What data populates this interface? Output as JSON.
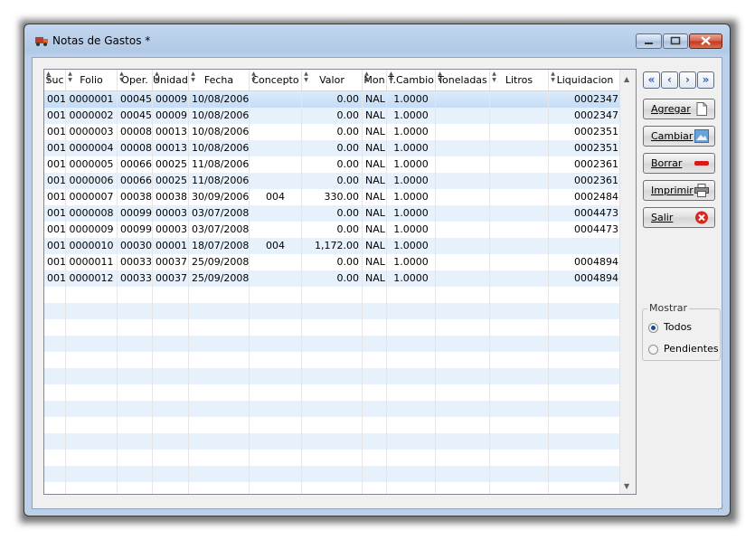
{
  "window": {
    "title": "Notas de Gastos *"
  },
  "grid": {
    "columns": [
      {
        "label": "Suc",
        "w": 24,
        "align": "l"
      },
      {
        "label": "Folio",
        "w": 57,
        "align": "c"
      },
      {
        "label": "Oper.",
        "w": 39,
        "align": "c"
      },
      {
        "label": "Unidad",
        "w": 40,
        "align": "c"
      },
      {
        "label": "Fecha",
        "w": 67,
        "align": "l"
      },
      {
        "label": "Concepto",
        "w": 58,
        "align": "c"
      },
      {
        "label": "Valor",
        "w": 67,
        "align": "r"
      },
      {
        "label": "Mon",
        "w": 27,
        "align": "l"
      },
      {
        "label": "T.Cambio",
        "w": 54,
        "align": "c"
      },
      {
        "label": "Toneladas",
        "w": 60,
        "align": "c"
      },
      {
        "label": "Litros",
        "w": 65,
        "align": "c"
      },
      {
        "label": "Liquidacion",
        "w": 81,
        "align": "r"
      }
    ],
    "rows": [
      [
        "001",
        "0000001",
        "00045",
        "00009",
        "10/08/2006",
        "",
        "0.00",
        "NAL",
        "1.0000",
        "",
        "",
        "0002347"
      ],
      [
        "001",
        "0000002",
        "00045",
        "00009",
        "10/08/2006",
        "",
        "0.00",
        "NAL",
        "1.0000",
        "",
        "",
        "0002347"
      ],
      [
        "001",
        "0000003",
        "00008",
        "00013",
        "10/08/2006",
        "",
        "0.00",
        "NAL",
        "1.0000",
        "",
        "",
        "0002351"
      ],
      [
        "001",
        "0000004",
        "00008",
        "00013",
        "10/08/2006",
        "",
        "0.00",
        "NAL",
        "1.0000",
        "",
        "",
        "0002351"
      ],
      [
        "001",
        "0000005",
        "00066",
        "00025",
        "11/08/2006",
        "",
        "0.00",
        "NAL",
        "1.0000",
        "",
        "",
        "0002361"
      ],
      [
        "001",
        "0000006",
        "00066",
        "00025",
        "11/08/2006",
        "",
        "0.00",
        "NAL",
        "1.0000",
        "",
        "",
        "0002361"
      ],
      [
        "001",
        "0000007",
        "00038",
        "00038",
        "30/09/2006",
        "004",
        "330.00",
        "NAL",
        "1.0000",
        "",
        "",
        "0002484"
      ],
      [
        "001",
        "0000008",
        "00099",
        "00003",
        "03/07/2008",
        "",
        "0.00",
        "NAL",
        "1.0000",
        "",
        "",
        "0004473"
      ],
      [
        "001",
        "0000009",
        "00099",
        "00003",
        "03/07/2008",
        "",
        "0.00",
        "NAL",
        "1.0000",
        "",
        "",
        "0004473"
      ],
      [
        "001",
        "0000010",
        "00030",
        "00001",
        "18/07/2008",
        "004",
        "1,172.00",
        "NAL",
        "1.0000",
        "",
        "",
        ""
      ],
      [
        "001",
        "0000011",
        "00033",
        "00037",
        "25/09/2008",
        "",
        "0.00",
        "NAL",
        "1.0000",
        "",
        "",
        "0004894"
      ],
      [
        "001",
        "0000012",
        "00033",
        "00037",
        "25/09/2008",
        "",
        "0.00",
        "NAL",
        "1.0000",
        "",
        "",
        "0004894"
      ]
    ],
    "empty_rows": 13
  },
  "buttons": {
    "agregar": "Agregar",
    "cambiar": "Cambiar",
    "borrar": "Borrar",
    "imprimir": "Imprimir",
    "salir": "Salir"
  },
  "filter": {
    "title": "Mostrar",
    "todos": "Todos",
    "pendientes": "Pendientes",
    "selected": "todos"
  },
  "colors": {
    "accent": "#2d62b2",
    "selected_row": "#cfe3f8",
    "alt_row": "#e6f1fc"
  }
}
